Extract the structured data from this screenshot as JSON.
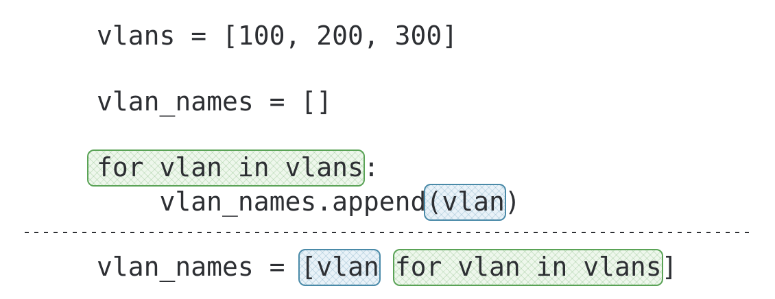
{
  "colors": {
    "text": "#2d2f33",
    "loop_highlight": "#5aa356",
    "value_highlight": "#4a8aa8",
    "divider": "#2d2f33"
  },
  "loop_version": {
    "line1": "vlans = [100, 200, 300]",
    "line2": "vlan_names = []",
    "line3_loop": "for vlan in vlans",
    "line3_colon": ":",
    "line4_prefix": "    vlan_names.append",
    "line4_paren_open": "(",
    "line4_value": "vlan",
    "line4_paren_close": ")"
  },
  "comprehension_version": {
    "prefix": "vlan_names = ",
    "bracket_open": "[",
    "value": "vlan",
    "gap": " ",
    "loop": "for vlan in vlans",
    "bracket_close": "]"
  }
}
